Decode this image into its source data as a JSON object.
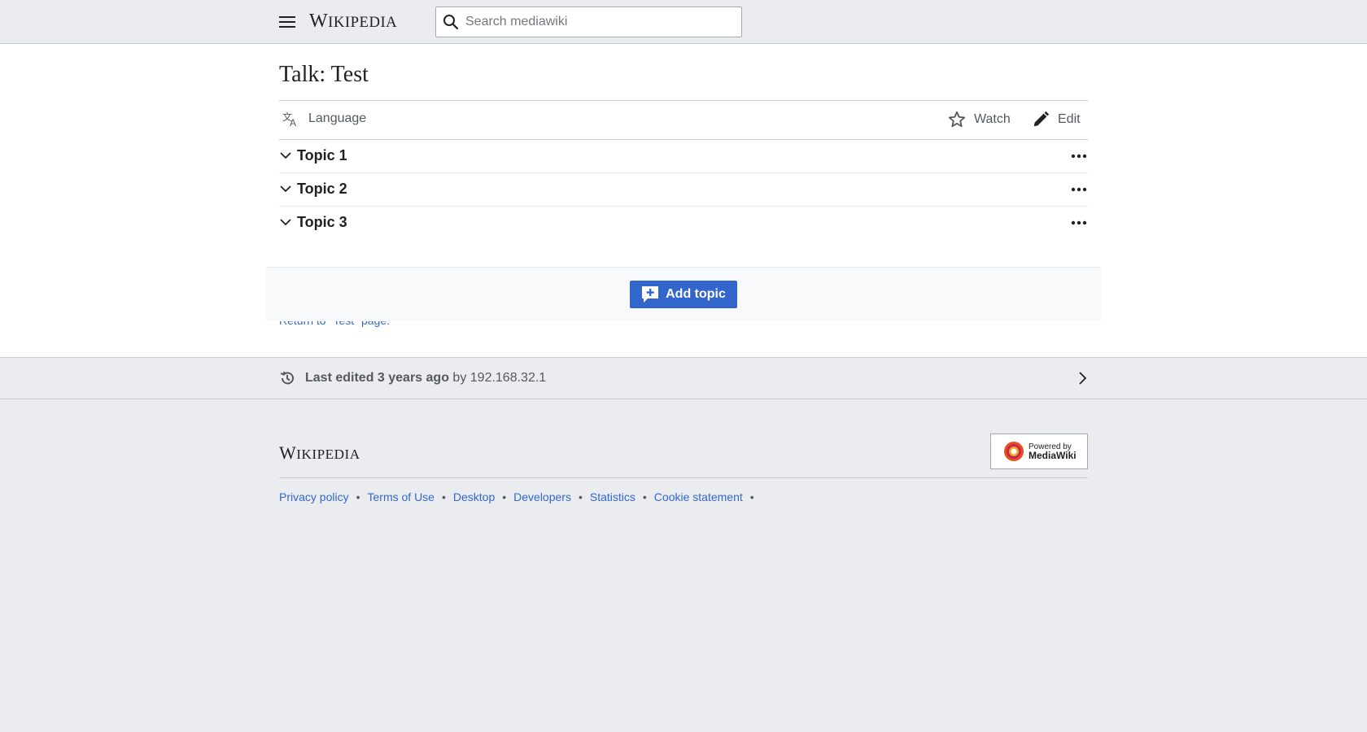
{
  "header": {
    "logo_first": "W",
    "logo_rest": "IKIPEDIA",
    "search_placeholder": "Search mediawiki"
  },
  "page": {
    "title": "Talk: Test",
    "toolbar": {
      "language": "Language",
      "watch": "Watch",
      "edit": "Edit"
    },
    "topics": [
      {
        "label": "Topic 1"
      },
      {
        "label": "Topic 2"
      },
      {
        "label": "Topic 3"
      }
    ],
    "return_link": "Return to \"Test\" page.",
    "add_topic": "Add topic"
  },
  "last_edited": {
    "prefix": "Last edited 3 years ago",
    "by": " by ",
    "user": "192.168.32.1"
  },
  "footer": {
    "logo_first": "W",
    "logo_rest": "IKIPEDIA",
    "powered_line1": "Powered by",
    "powered_line2": "MediaWiki",
    "links": [
      "Privacy policy",
      "Terms of Use",
      "Desktop",
      "Developers",
      "Statistics",
      "Cookie statement"
    ]
  },
  "colors": {
    "link": "#3366cc",
    "accent_button": "#3366cc",
    "chrome_bg": "#eaecf0",
    "text": "#202122",
    "subtle_text": "#54595d"
  },
  "icons": {
    "menu": "hamburger-icon",
    "search": "search-icon",
    "language": "translate-icon",
    "watch": "star-icon",
    "edit": "pencil-icon",
    "topic_toggle": "chevron-down-icon",
    "topic_more": "ellipsis-icon",
    "add_topic": "speech-bubble-add-icon",
    "history": "history-icon",
    "last_edited_arrow": "chevron-right-icon",
    "powered": "mediawiki-logo"
  }
}
